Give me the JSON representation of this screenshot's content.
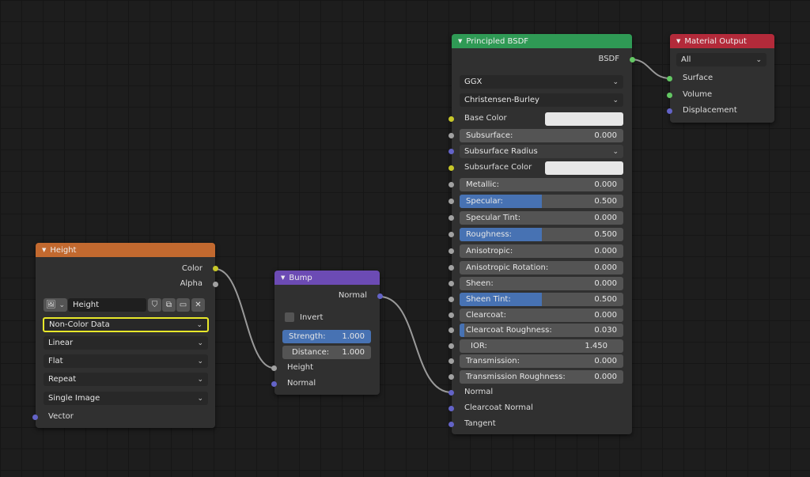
{
  "height_node": {
    "title": "Height",
    "outputs": [
      "Color",
      "Alpha"
    ],
    "image_name": "Height",
    "color_space": "Non-Color Data",
    "interpolation": "Linear",
    "projection": "Flat",
    "extension": "Repeat",
    "source": "Single Image",
    "input_vector": "Vector"
  },
  "bump_node": {
    "title": "Bump",
    "output_normal": "Normal",
    "invert_label": "Invert",
    "strength_label": "Strength:",
    "strength_value": "1.000",
    "distance_label": "Distance:",
    "distance_value": "1.000",
    "input_height": "Height",
    "input_normal": "Normal"
  },
  "bsdf_node": {
    "title": "Principled BSDF",
    "output": "BSDF",
    "distribution": "GGX",
    "subsurface_method": "Christensen-Burley",
    "base_color_label": "Base Color",
    "subsurface_radius_label": "Subsurface Radius",
    "subsurface_color_label": "Subsurface Color",
    "rows": [
      {
        "label": "Subsurface:",
        "value": "0.000",
        "fill": 0.0
      },
      {
        "label": "Metallic:",
        "value": "0.000",
        "fill": 0.0
      },
      {
        "label": "Specular:",
        "value": "0.500",
        "fill": 0.5
      },
      {
        "label": "Specular Tint:",
        "value": "0.000",
        "fill": 0.0
      },
      {
        "label": "Roughness:",
        "value": "0.500",
        "fill": 0.5
      },
      {
        "label": "Anisotropic:",
        "value": "0.000",
        "fill": 0.0
      },
      {
        "label": "Anisotropic Rotation:",
        "value": "0.000",
        "fill": 0.0
      },
      {
        "label": "Sheen:",
        "value": "0.000",
        "fill": 0.0
      },
      {
        "label": "Sheen Tint:",
        "value": "0.500",
        "fill": 0.5
      },
      {
        "label": "Clearcoat:",
        "value": "0.000",
        "fill": 0.0
      },
      {
        "label": "Clearcoat Roughness:",
        "value": "0.030",
        "fill": 0.03
      },
      {
        "label": "IOR:",
        "value": "1.450",
        "fill": 0.0
      },
      {
        "label": "Transmission:",
        "value": "0.000",
        "fill": 0.0
      },
      {
        "label": "Transmission Roughness:",
        "value": "0.000",
        "fill": 0.0
      }
    ],
    "input_normal": "Normal",
    "input_clearcoat_normal": "Clearcoat Normal",
    "input_tangent": "Tangent"
  },
  "output_node": {
    "title": "Material Output",
    "target": "All",
    "inputs": [
      "Surface",
      "Volume",
      "Displacement"
    ]
  },
  "colors": {
    "texture_header": "#c2692f",
    "vector_header": "#6c4bb4",
    "shader_header": "#2f9a55",
    "output_header": "#b32a3a",
    "highlight": "#e8e82a"
  }
}
